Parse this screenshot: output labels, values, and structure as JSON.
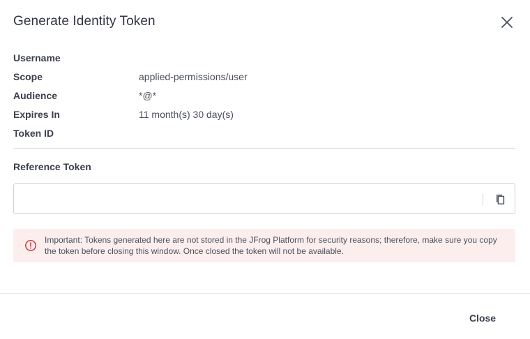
{
  "dialog": {
    "title": "Generate Identity Token",
    "close_icon": "close-icon"
  },
  "details": [
    {
      "label": "Username",
      "value": ""
    },
    {
      "label": "Scope",
      "value": "applied-permissions/user"
    },
    {
      "label": "Audience",
      "value": "*@*"
    },
    {
      "label": "Expires In",
      "value": "11 month(s) 30 day(s)"
    },
    {
      "label": "Token ID",
      "value": ""
    }
  ],
  "reference_token": {
    "label": "Reference Token",
    "value": "",
    "copy_icon": "copy-icon"
  },
  "alert": {
    "icon": "error-circle-icon",
    "text": "Important: Tokens generated here are not stored in the JFrog Platform for security reasons; therefore, make sure you copy the token before closing this window. Once closed the token will not be available.",
    "background": "#fdeeee",
    "icon_color": "#d9383a"
  },
  "footer": {
    "close_label": "Close"
  }
}
